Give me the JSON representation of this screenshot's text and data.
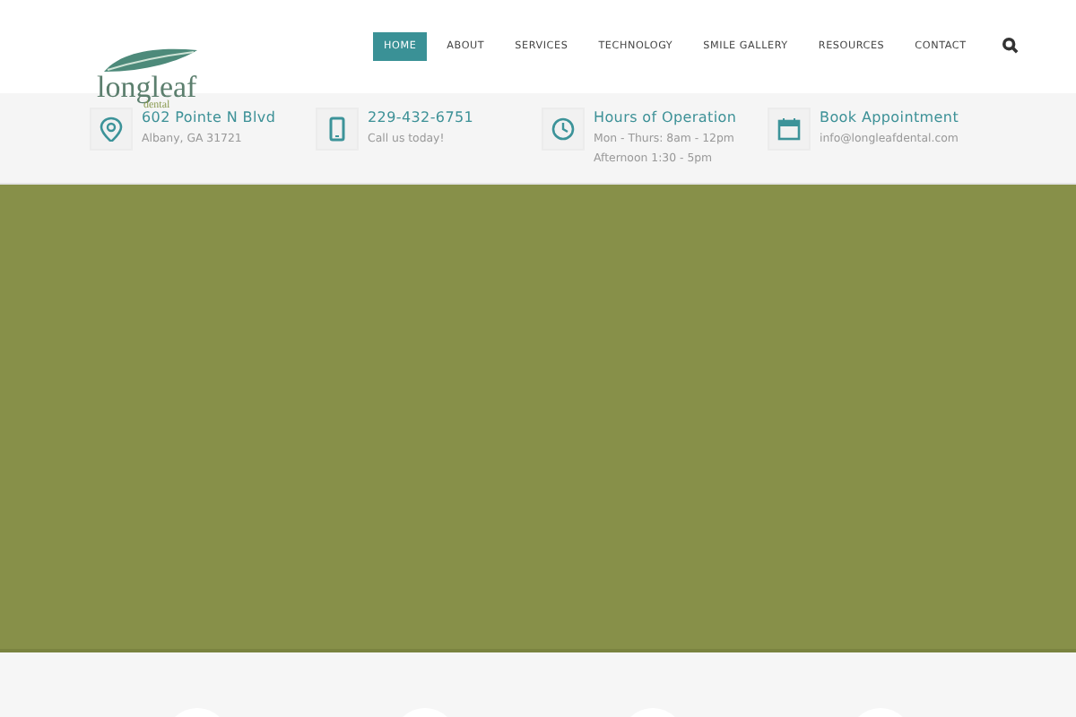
{
  "logo": {
    "name": "longleaf",
    "tagline": "dental"
  },
  "nav": [
    {
      "label": "HOME",
      "selected": true
    },
    {
      "label": "ABOUT",
      "selected": false
    },
    {
      "label": "SERVICES",
      "selected": false
    },
    {
      "label": "TECHNOLOGY",
      "selected": false
    },
    {
      "label": "SMILE GALLERY",
      "selected": false
    },
    {
      "label": "RESOURCES",
      "selected": false
    },
    {
      "label": "CONTACT",
      "selected": false
    }
  ],
  "info": [
    {
      "kind": "pin",
      "title": "602 Pointe N Blvd",
      "lines": [
        "Albany, GA 31721"
      ]
    },
    {
      "kind": "phone",
      "title": "229-432-6751",
      "lines": [
        "Call us today!"
      ]
    },
    {
      "kind": "clock",
      "title": "Hours of Operation",
      "lines": [
        "Mon - Thurs: 8am - 12pm",
        "Afternoon 1:30 - 5pm"
      ]
    },
    {
      "kind": "calendar",
      "title": "Book Appointment",
      "lines": [
        "info@longleafdental.com"
      ]
    }
  ]
}
